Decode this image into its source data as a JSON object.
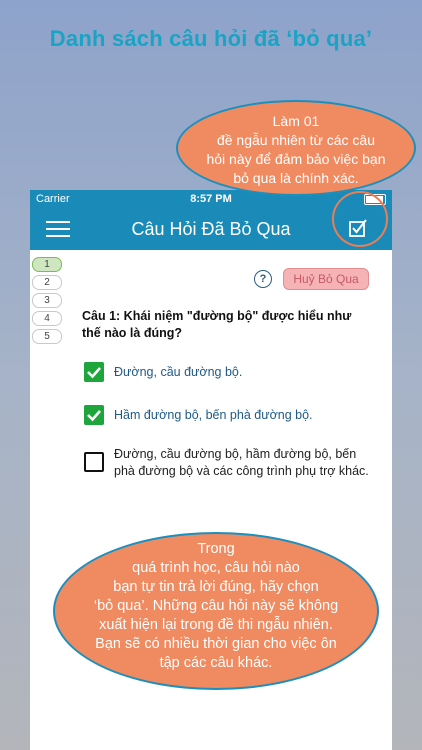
{
  "headline": "Danh sách câu hỏi đã ‘bỏ qua’",
  "status_bar": {
    "carrier": "Carrier",
    "time": "8:57 PM"
  },
  "nav": {
    "title": "Câu Hỏi Đã Bỏ Qua",
    "menu_icon": "hamburger-menu-icon",
    "action_icon": "checkbox-edit-icon"
  },
  "pager": [
    "1",
    "2",
    "3",
    "4",
    "5"
  ],
  "help_label": "?",
  "skip_button": "Huỷ Bỏ Qua",
  "question": "Câu 1: Khái niệm \"đường bộ\" được hiểu như thế nào là đúng?",
  "options": [
    {
      "text": "Đường, cầu đường bộ.",
      "checked": true
    },
    {
      "text": "Hầm đường bộ, bến phà đường bộ.",
      "checked": true
    },
    {
      "text": "Đường, cầu đường bộ, hầm đường bộ, bến phà đường bộ và các công trình phụ trợ khác.",
      "checked": false
    }
  ],
  "callout_top": [
    "Làm 01",
    "đề ngẫu nhiên từ các câu",
    "hỏi này để đảm bảo việc bạn",
    "bỏ qua là chính xác."
  ],
  "callout_bottom": [
    "Trong",
    "quá trình học, câu hỏi nào",
    "bạn tự tin trả lời đúng, hãy chọn",
    "‘bỏ qua’. Những câu hỏi này sẽ không",
    "xuất hiện lại trong đề thi ngẫu nhiên.",
    "Bạn sẽ có nhiều thời gian cho việc ôn",
    "tập các câu khác."
  ],
  "colors": {
    "accent": "#1a8bb8",
    "callout": "#f08a60",
    "check": "#1ea63c"
  }
}
